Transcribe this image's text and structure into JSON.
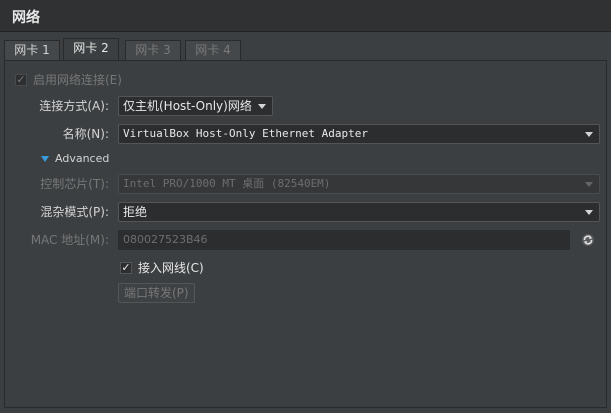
{
  "window": {
    "title": "网络"
  },
  "tabs": [
    {
      "label": "网卡 1",
      "state": "normal"
    },
    {
      "label": "网卡 2",
      "state": "active"
    },
    {
      "label": "网卡 3",
      "state": "disabled"
    },
    {
      "label": "网卡 4",
      "state": "disabled"
    }
  ],
  "form": {
    "enable_label": "启用网络连接(E)",
    "enable_checked": true,
    "attach_label": "连接方式(A):",
    "attach_value": "仅主机(Host-Only)网络",
    "name_label": "名称(N):",
    "name_value": "VirtualBox Host-Only Ethernet Adapter",
    "advanced_label": "Advanced",
    "adapter_type_label": "控制芯片(T):",
    "adapter_type_value": "Intel PRO/1000 MT 桌面 (82540EM)",
    "promisc_label": "混杂模式(P):",
    "promisc_value": "拒绝",
    "mac_label": "MAC 地址(M):",
    "mac_value": "080027523B46",
    "cable_label": "接入网线(C)",
    "cable_checked": true,
    "port_forward_label": "端口转发(P)"
  },
  "colors": {
    "accent": "#3a9bdc",
    "background": "#3c3f41"
  },
  "icons": {
    "check": "✓",
    "refresh": "refresh-icon",
    "disclosure": "triangle-down-icon"
  }
}
